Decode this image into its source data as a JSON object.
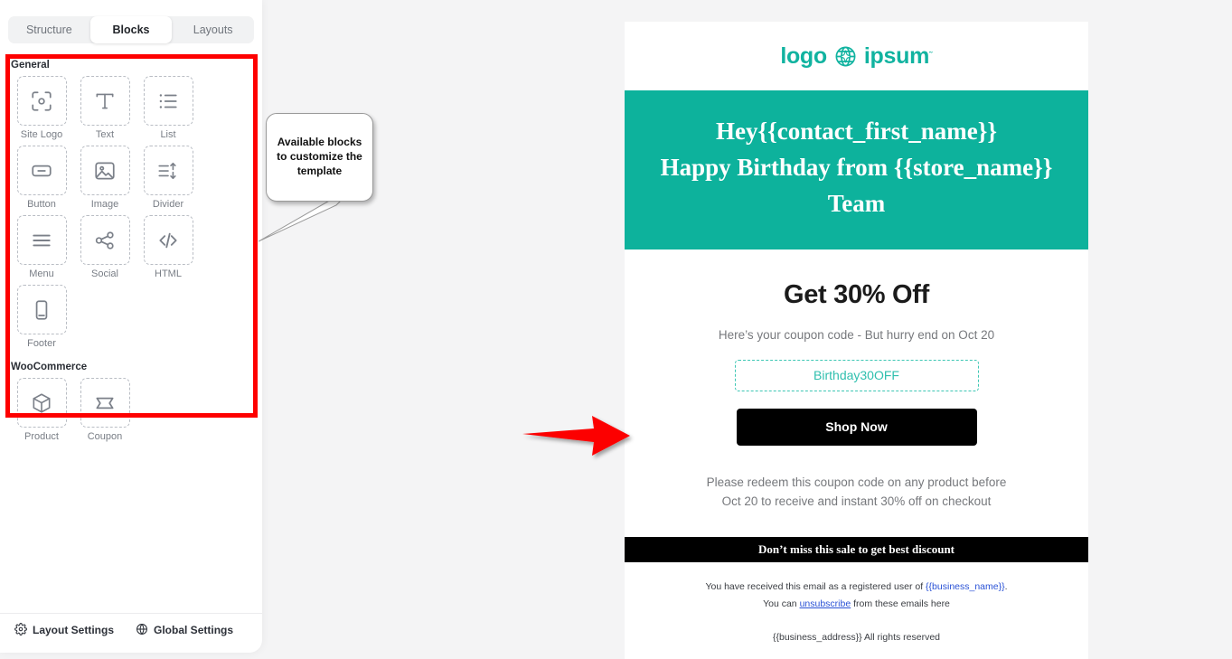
{
  "theme": {
    "accent_teal": "#0db29c",
    "annotation_red": "#fe0000",
    "link_blue": "#2a52d6",
    "page_bg": "#f4f4f5"
  },
  "sidebar": {
    "tabs": [
      {
        "label": "Structure",
        "active": false
      },
      {
        "label": "Blocks",
        "active": true
      },
      {
        "label": "Layouts",
        "active": false
      }
    ],
    "groups": [
      {
        "title": "General",
        "blocks": [
          {
            "label": "Site Logo",
            "icon": "site-logo-icon"
          },
          {
            "label": "Text",
            "icon": "text-icon"
          },
          {
            "label": "List",
            "icon": "list-icon"
          },
          {
            "label": "Button",
            "icon": "button-icon"
          },
          {
            "label": "Image",
            "icon": "image-icon"
          },
          {
            "label": "Divider",
            "icon": "divider-icon"
          },
          {
            "label": "Menu",
            "icon": "menu-icon"
          },
          {
            "label": "Social",
            "icon": "social-share-icon"
          },
          {
            "label": "HTML",
            "icon": "code-icon"
          },
          {
            "label": "Footer",
            "icon": "footer-icon"
          }
        ]
      },
      {
        "title": "WooCommerce",
        "blocks": [
          {
            "label": "Product",
            "icon": "product-box-icon"
          },
          {
            "label": "Coupon",
            "icon": "coupon-ticket-icon"
          }
        ]
      }
    ],
    "footer_actions": [
      {
        "label": "Layout Settings",
        "icon": "gear-icon"
      },
      {
        "label": "Global Settings",
        "icon": "globe-icon"
      }
    ]
  },
  "annotations": {
    "callout_text": "Available blocks to customize the template",
    "arrow": "red-arrow-pointing-right"
  },
  "email": {
    "logo": {
      "text_left": "logo",
      "text_right": "ipsum",
      "trademark": "˜",
      "icon": "globe-logo-icon"
    },
    "hero_lines": [
      "Hey{{contact_first_name}}",
      "Happy Birthday from {{store_name}}",
      "Team"
    ],
    "offer_title": "Get 30% Off",
    "offer_subtitle": "Here’s your coupon code - But hurry end on Oct 20",
    "coupon_code": "Birthday30OFF",
    "cta_label": "Shop Now",
    "redeem_lines": [
      "Please redeem this coupon code on any product before",
      "Oct 20 to receive and instant 30% off on checkout"
    ],
    "black_bar_text": "Don’t miss this sale to get best discount",
    "footer": {
      "line1_prefix": "You have received this email as a registered user of ",
      "line1_link": "{{business_name}}",
      "line1_suffix": ".",
      "line2_prefix": "You can ",
      "line2_link": "unsubscribe",
      "line2_suffix": " from these emails here",
      "address_line": "{{business_address}}  All rights reserved"
    }
  }
}
